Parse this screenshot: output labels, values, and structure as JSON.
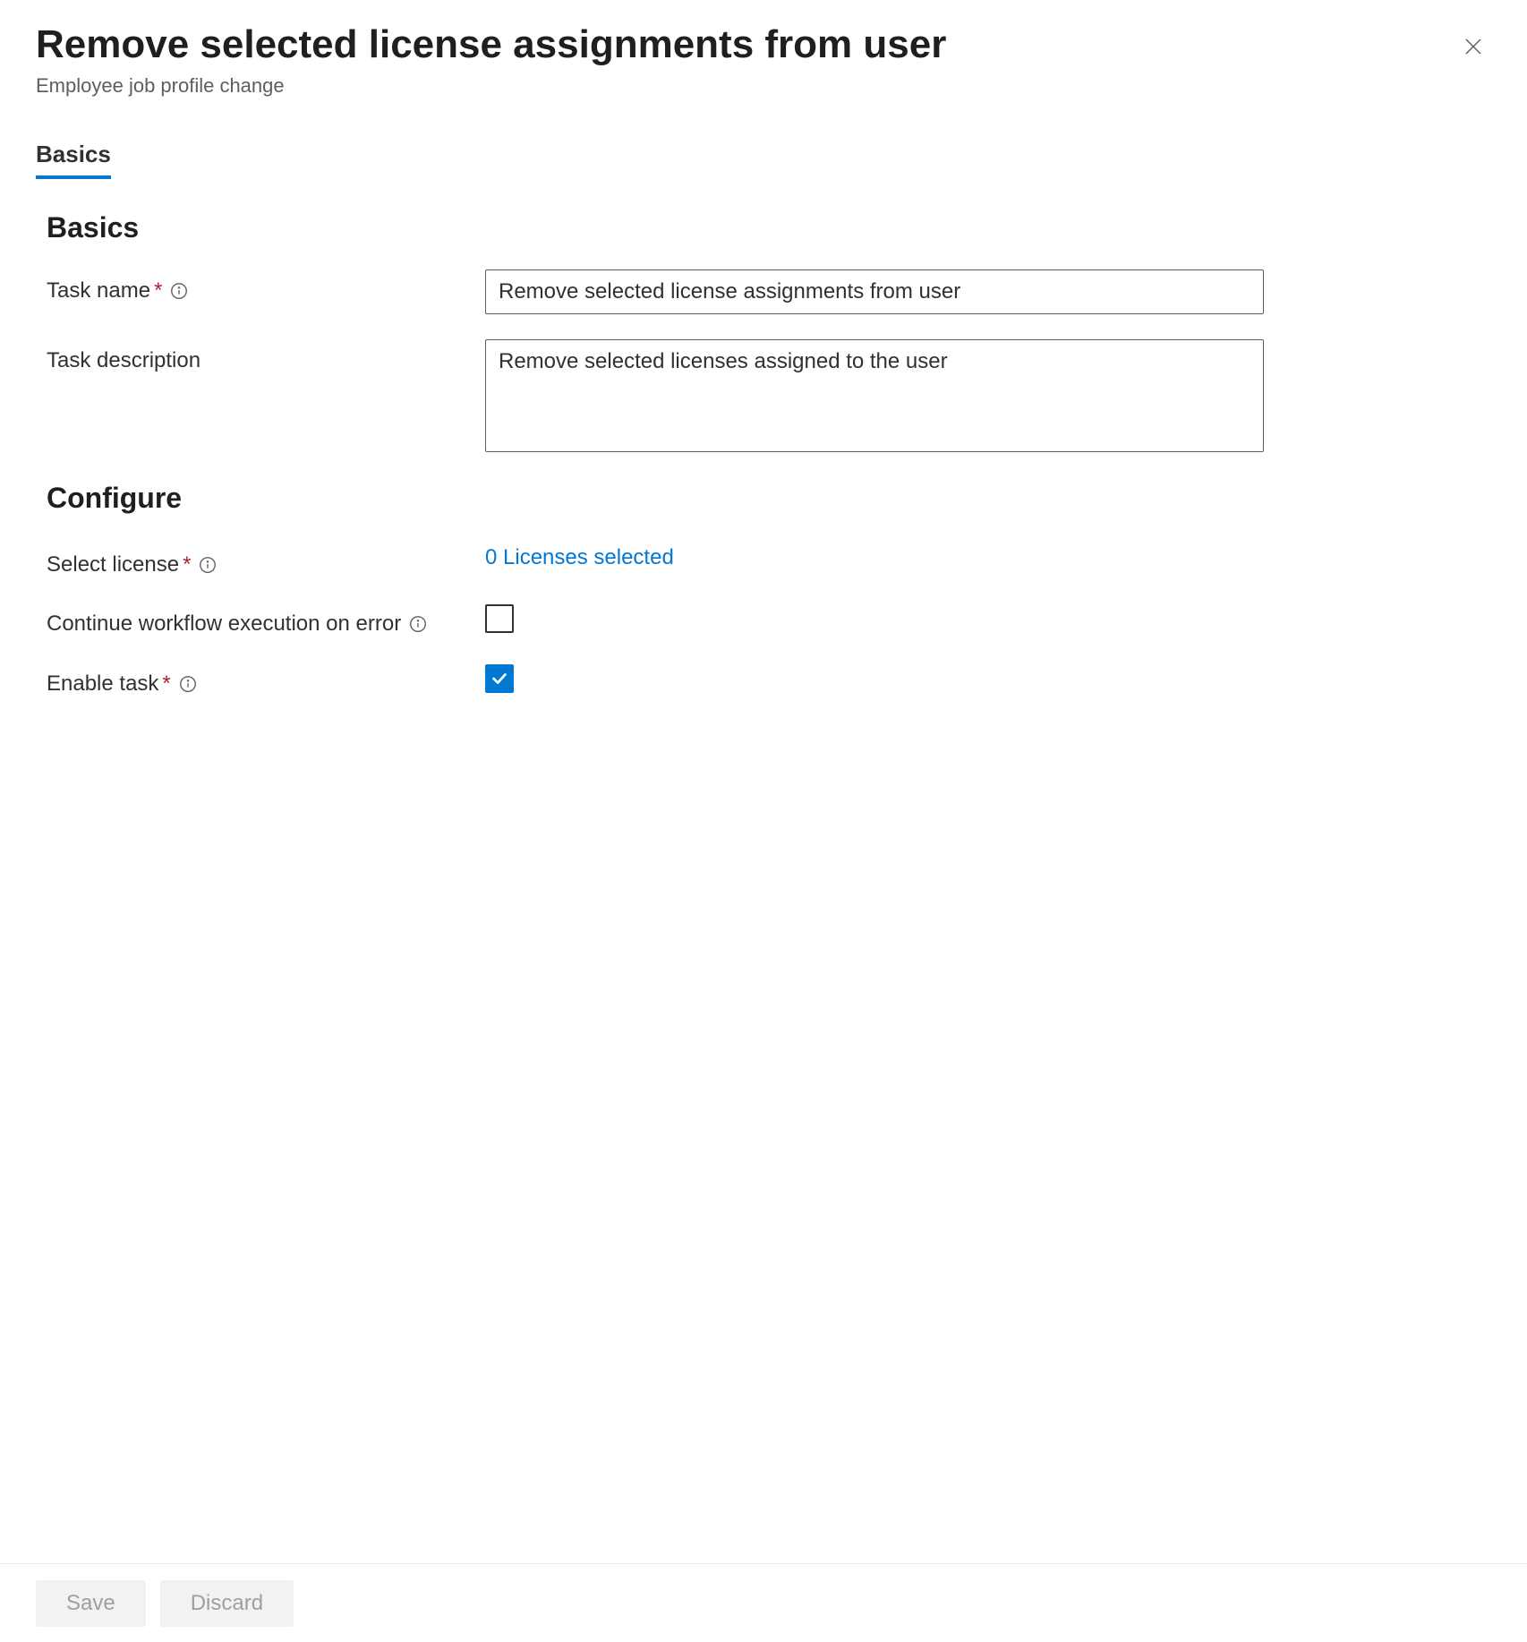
{
  "header": {
    "title": "Remove selected license assignments from user",
    "subtitle": "Employee job profile change"
  },
  "tabs": {
    "basics": "Basics"
  },
  "sections": {
    "basics_title": "Basics",
    "configure_title": "Configure"
  },
  "form": {
    "task_name_label": "Task name",
    "task_name_value": "Remove selected license assignments from user",
    "task_description_label": "Task description",
    "task_description_value": "Remove selected licenses assigned to the user",
    "select_license_label": "Select license",
    "select_license_value": "0 Licenses selected",
    "continue_on_error_label": "Continue workflow execution on error",
    "continue_on_error_checked": false,
    "enable_task_label": "Enable task",
    "enable_task_checked": true
  },
  "footer": {
    "save": "Save",
    "discard": "Discard"
  }
}
